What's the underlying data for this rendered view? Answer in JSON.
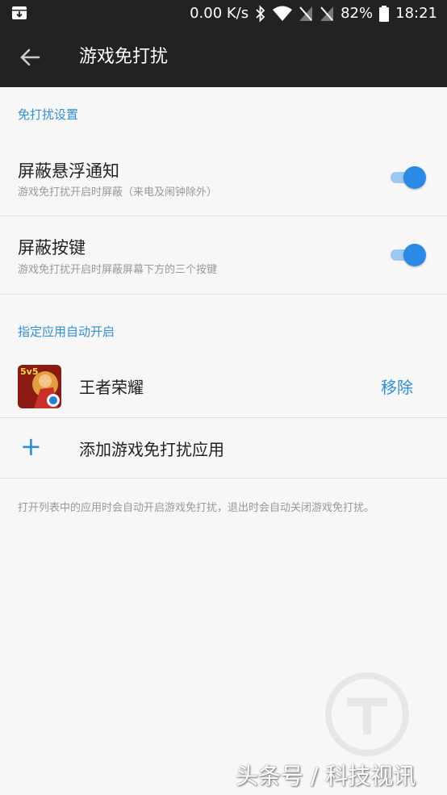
{
  "status_bar": {
    "speed": "0.00 K/s",
    "battery": "82%",
    "time": "18:21"
  },
  "app_bar": {
    "title": "游戏免打扰"
  },
  "section1": {
    "header": "免打扰设置",
    "items": [
      {
        "label": "屏蔽悬浮通知",
        "sub": "游戏免打扰开启时屏蔽（来电及闹钟除外）",
        "enabled": true
      },
      {
        "label": "屏蔽按键",
        "sub": "游戏免打扰开启时屏蔽屏幕下方的三个按键",
        "enabled": true
      }
    ]
  },
  "section2": {
    "header": "指定应用自动开启",
    "app": {
      "name": "王者荣耀",
      "action": "移除",
      "icon_badge": "5v5"
    },
    "add_label": "添加游戏免打扰应用",
    "add_icon": "+"
  },
  "footnote": "打开列表中的应用时会自动开启游戏免打扰，退出时会自动关闭游戏免打扰。",
  "watermark": "头条号 / 科技视讯",
  "colors": {
    "accent": "#2f8fd8",
    "toggle_on": "#2b8ae6",
    "bar_bg": "#222222",
    "page_bg": "#f7f7f7"
  }
}
